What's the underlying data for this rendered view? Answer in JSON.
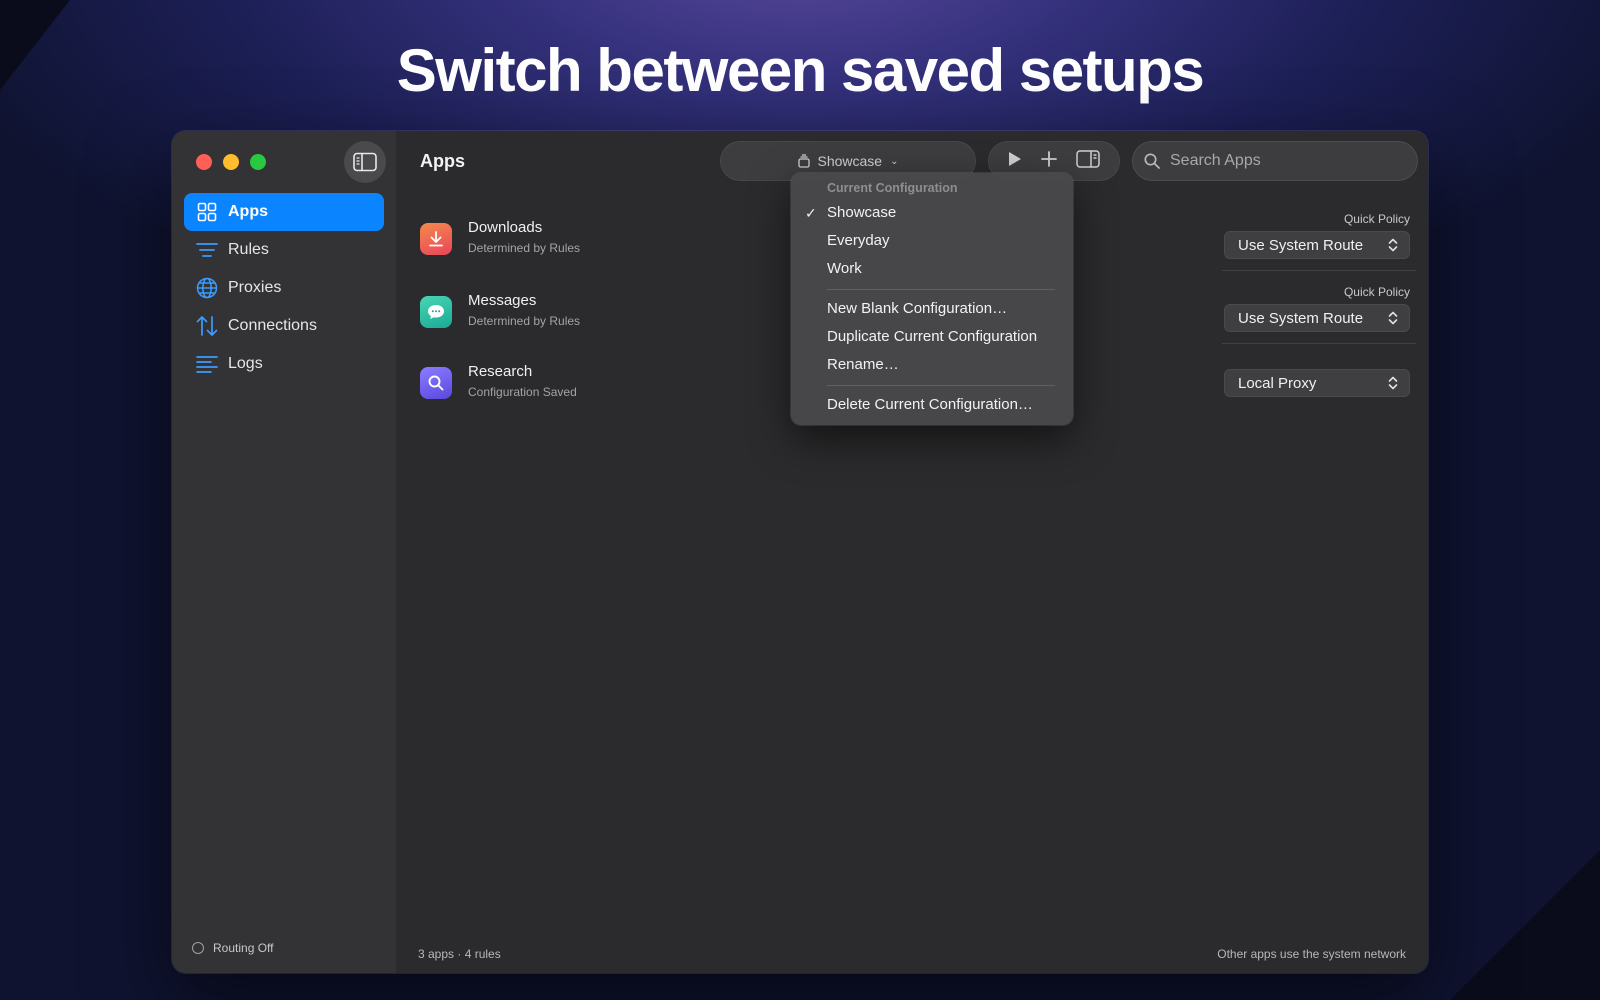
{
  "headline": "Switch between saved setups",
  "sidebar": {
    "items": [
      {
        "label": "Apps",
        "icon": "grid-icon",
        "active": true
      },
      {
        "label": "Rules",
        "icon": "rules-icon"
      },
      {
        "label": "Proxies",
        "icon": "globe-icon"
      },
      {
        "label": "Connections",
        "icon": "arrows-updown-icon"
      },
      {
        "label": "Logs",
        "icon": "lines-icon"
      }
    ],
    "status": "Routing Off"
  },
  "main": {
    "title": "Apps",
    "toolbar": {
      "config_label": "Showcase"
    },
    "search": {
      "placeholder": "Search Apps"
    },
    "apps": [
      {
        "name": "Downloads",
        "sub": "Determined by Rules",
        "policy_label": "Quick Policy",
        "policy": "Use System Route",
        "icon_color": "#ef6a3a"
      },
      {
        "name": "Messages",
        "sub": "Determined by Rules",
        "policy_label": "Quick Policy",
        "policy": "Use System Route",
        "icon_color": "#2ec4a6"
      },
      {
        "name": "Research",
        "sub": "Configuration Saved",
        "policy_label": "",
        "policy": "Local Proxy",
        "icon_color": "#6b5cf0"
      }
    ],
    "footer": {
      "summary": "3 apps · 4 rules",
      "note": "Other apps use the system network"
    }
  },
  "menu": {
    "header": "Current Configuration",
    "configs": [
      {
        "label": "Showcase",
        "checked": true
      },
      {
        "label": "Everyday",
        "checked": false
      },
      {
        "label": "Work",
        "checked": false
      }
    ],
    "actions": [
      "New Blank Configuration…",
      "Duplicate Current Configuration",
      "Rename…"
    ],
    "danger": "Delete Current Configuration…",
    "check_glyph": "✓"
  },
  "colors": {
    "accent": "#0a84ff",
    "window_bg": "#2b2a2c",
    "sidebar_bg": "#333234"
  }
}
